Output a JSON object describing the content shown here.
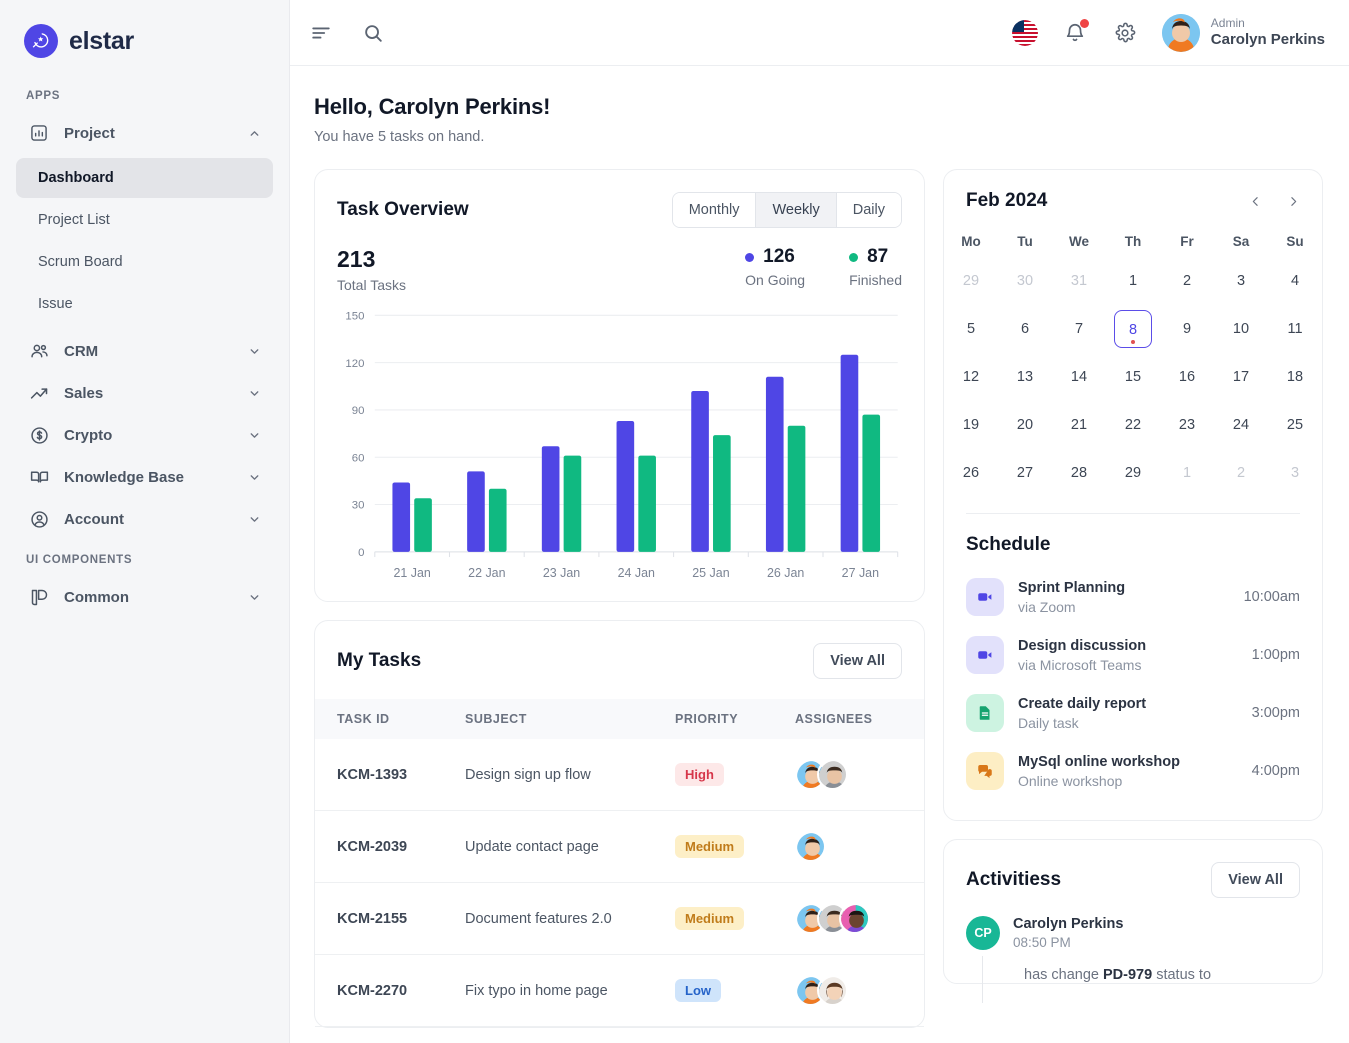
{
  "brand": {
    "name": "elstar",
    "logo_icon": "star-bolt-icon",
    "accent": "#4f46e5"
  },
  "sidebar": {
    "sections": [
      {
        "title": "APPS",
        "items": [
          {
            "label": "Project",
            "icon": "chart-bar-square-icon",
            "expanded": true,
            "children": [
              {
                "label": "Dashboard",
                "active": true
              },
              {
                "label": "Project List",
                "active": false
              },
              {
                "label": "Scrum Board",
                "active": false
              },
              {
                "label": "Issue",
                "active": false
              }
            ]
          },
          {
            "label": "CRM",
            "icon": "users-group-icon",
            "expanded": false
          },
          {
            "label": "Sales",
            "icon": "trending-up-icon",
            "expanded": false
          },
          {
            "label": "Crypto",
            "icon": "dollar-circle-icon",
            "expanded": false
          },
          {
            "label": "Knowledge Base",
            "icon": "open-book-icon",
            "expanded": false
          },
          {
            "label": "Account",
            "icon": "user-circle-icon",
            "expanded": false
          }
        ]
      },
      {
        "title": "UI COMPONENTS",
        "items": [
          {
            "label": "Common",
            "icon": "layers-icon",
            "expanded": false
          }
        ]
      }
    ]
  },
  "topbar": {
    "menu_icon": "hamburger-menu-icon",
    "search_icon": "search-icon",
    "flag_icon": "us-flag-icon",
    "notification_icon": "bell-icon",
    "has_notification": true,
    "settings_icon": "gear-icon",
    "user": {
      "role": "Admin",
      "name": "Carolyn Perkins",
      "avatar_icon": "user-avatar"
    }
  },
  "greeting": {
    "title": "Hello, Carolyn Perkins!",
    "subtitle": "You have 5 tasks on hand."
  },
  "task_overview": {
    "title": "Task Overview",
    "range_tabs": [
      {
        "label": "Monthly",
        "active": false
      },
      {
        "label": "Weekly",
        "active": true
      },
      {
        "label": "Daily",
        "active": false
      }
    ],
    "total": {
      "value": "213",
      "label": "Total Tasks"
    },
    "ongoing": {
      "value": "126",
      "label": "On Going",
      "color": "#4f46e5"
    },
    "finished": {
      "value": "87",
      "label": "Finished",
      "color": "#10b981"
    }
  },
  "chart_data": {
    "type": "bar",
    "title": "Task Overview",
    "categories": [
      "21 Jan",
      "22 Jan",
      "23 Jan",
      "24 Jan",
      "25 Jan",
      "26 Jan",
      "27 Jan"
    ],
    "series": [
      {
        "name": "On Going",
        "color": "#4f46e5",
        "values": [
          44,
          51,
          67,
          83,
          102,
          111,
          125
        ]
      },
      {
        "name": "Finished",
        "color": "#10b981",
        "values": [
          34,
          40,
          61,
          61,
          74,
          80,
          87
        ]
      }
    ],
    "xlabel": "",
    "ylabel": "",
    "ylim": [
      0,
      150
    ],
    "yticks": [
      0,
      30,
      60,
      90,
      120,
      150
    ],
    "grid": true,
    "legend_position": "top-right"
  },
  "my_tasks": {
    "title": "My Tasks",
    "view_all_label": "View All",
    "columns": [
      "TASK ID",
      "SUBJECT",
      "PRIORITY",
      "ASSIGNEES"
    ],
    "rows": [
      {
        "id": "KCM-1393",
        "subject": "Design sign up flow",
        "priority": "High",
        "priority_class": "high",
        "assignees": 2
      },
      {
        "id": "KCM-2039",
        "subject": "Update contact page",
        "priority": "Medium",
        "priority_class": "medium",
        "assignees": 1
      },
      {
        "id": "KCM-2155",
        "subject": "Document features 2.0",
        "priority": "Medium",
        "priority_class": "medium",
        "assignees": 3
      },
      {
        "id": "KCM-2270",
        "subject": "Fix typo in home page",
        "priority": "Low",
        "priority_class": "low",
        "assignees": 2
      }
    ]
  },
  "calendar": {
    "title": "Feb 2024",
    "prev_icon": "chevron-left-icon",
    "next_icon": "chevron-right-icon",
    "weekdays": [
      "Mo",
      "Tu",
      "We",
      "Th",
      "Fr",
      "Sa",
      "Su"
    ],
    "weeks": [
      [
        {
          "d": "29",
          "muted": true
        },
        {
          "d": "30",
          "muted": true
        },
        {
          "d": "31",
          "muted": true
        },
        {
          "d": "1"
        },
        {
          "d": "2"
        },
        {
          "d": "3"
        },
        {
          "d": "4"
        }
      ],
      [
        {
          "d": "5"
        },
        {
          "d": "6"
        },
        {
          "d": "7"
        },
        {
          "d": "8",
          "today": true,
          "event": true
        },
        {
          "d": "9"
        },
        {
          "d": "10"
        },
        {
          "d": "11"
        }
      ],
      [
        {
          "d": "12"
        },
        {
          "d": "13"
        },
        {
          "d": "14"
        },
        {
          "d": "15"
        },
        {
          "d": "16"
        },
        {
          "d": "17"
        },
        {
          "d": "18"
        }
      ],
      [
        {
          "d": "19"
        },
        {
          "d": "20"
        },
        {
          "d": "21"
        },
        {
          "d": "22"
        },
        {
          "d": "23"
        },
        {
          "d": "24"
        },
        {
          "d": "25"
        }
      ],
      [
        {
          "d": "26"
        },
        {
          "d": "27"
        },
        {
          "d": "28"
        },
        {
          "d": "29"
        },
        {
          "d": "1",
          "muted": true
        },
        {
          "d": "2",
          "muted": true
        },
        {
          "d": "3",
          "muted": true
        }
      ]
    ]
  },
  "schedule": {
    "title": "Schedule",
    "items": [
      {
        "name": "Sprint Planning",
        "desc": "via Zoom",
        "time": "10:00am",
        "icon": "video-camera-icon",
        "tone": "violet"
      },
      {
        "name": "Design discussion",
        "desc": "via Microsoft Teams",
        "time": "1:00pm",
        "icon": "video-camera-icon",
        "tone": "violet"
      },
      {
        "name": "Create daily report",
        "desc": "Daily task",
        "time": "3:00pm",
        "icon": "document-icon",
        "tone": "green"
      },
      {
        "name": "MySql online workshop",
        "desc": "Online workshop",
        "time": "4:00pm",
        "icon": "chat-bubbles-icon",
        "tone": "amber"
      }
    ]
  },
  "activities": {
    "title": "Activitiess",
    "view_all_label": "View All",
    "items": [
      {
        "initials": "CP",
        "name": "Carolyn Perkins",
        "time": "08:50 PM",
        "detail_prefix": "has change",
        "detail_ticket": "PD-979",
        "detail_suffix": "status to"
      }
    ]
  }
}
